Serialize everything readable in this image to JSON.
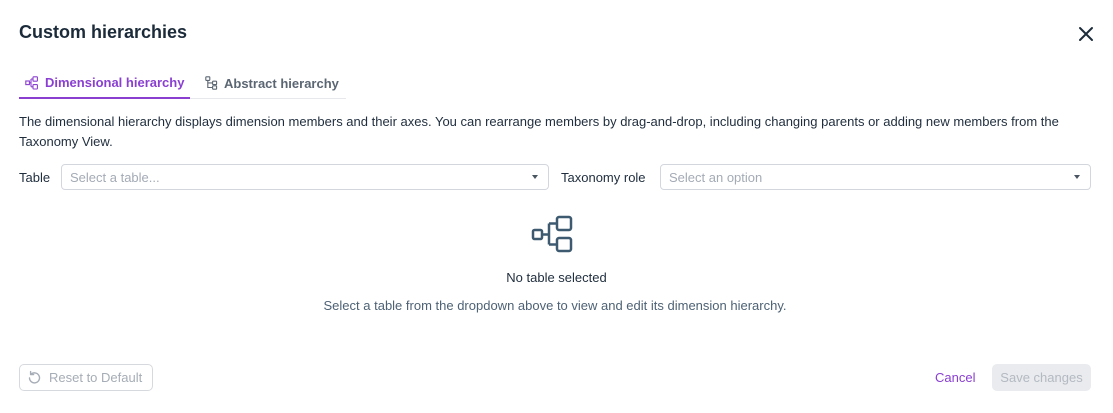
{
  "dialog": {
    "title": "Custom hierarchies",
    "close_icon": "close-icon"
  },
  "tabs": [
    {
      "label": "Dimensional hierarchy",
      "icon": "dimensional-hierarchy-icon",
      "active": true
    },
    {
      "label": "Abstract hierarchy",
      "icon": "abstract-hierarchy-icon",
      "active": false
    }
  ],
  "description": "The dimensional hierarchy displays dimension members and their axes. You can rearrange members by drag-and-drop, including changing parents or adding new members from the Taxonomy View.",
  "filters": {
    "table": {
      "label": "Table",
      "placeholder": "Select a table..."
    },
    "taxonomy_role": {
      "label": "Taxonomy role",
      "placeholder": "Select an option"
    }
  },
  "empty_state": {
    "icon": "hierarchy-icon",
    "title": "No table selected",
    "subtitle": "Select a table from the dropdown above to view and edit its dimension hierarchy."
  },
  "footer": {
    "reset_label": "Reset to Default",
    "reset_icon": "reset-icon",
    "cancel_label": "Cancel",
    "save_label": "Save changes"
  },
  "colors": {
    "accent": "#8a3fd1",
    "text": "#1f2d3d",
    "muted": "#a4abb5"
  }
}
